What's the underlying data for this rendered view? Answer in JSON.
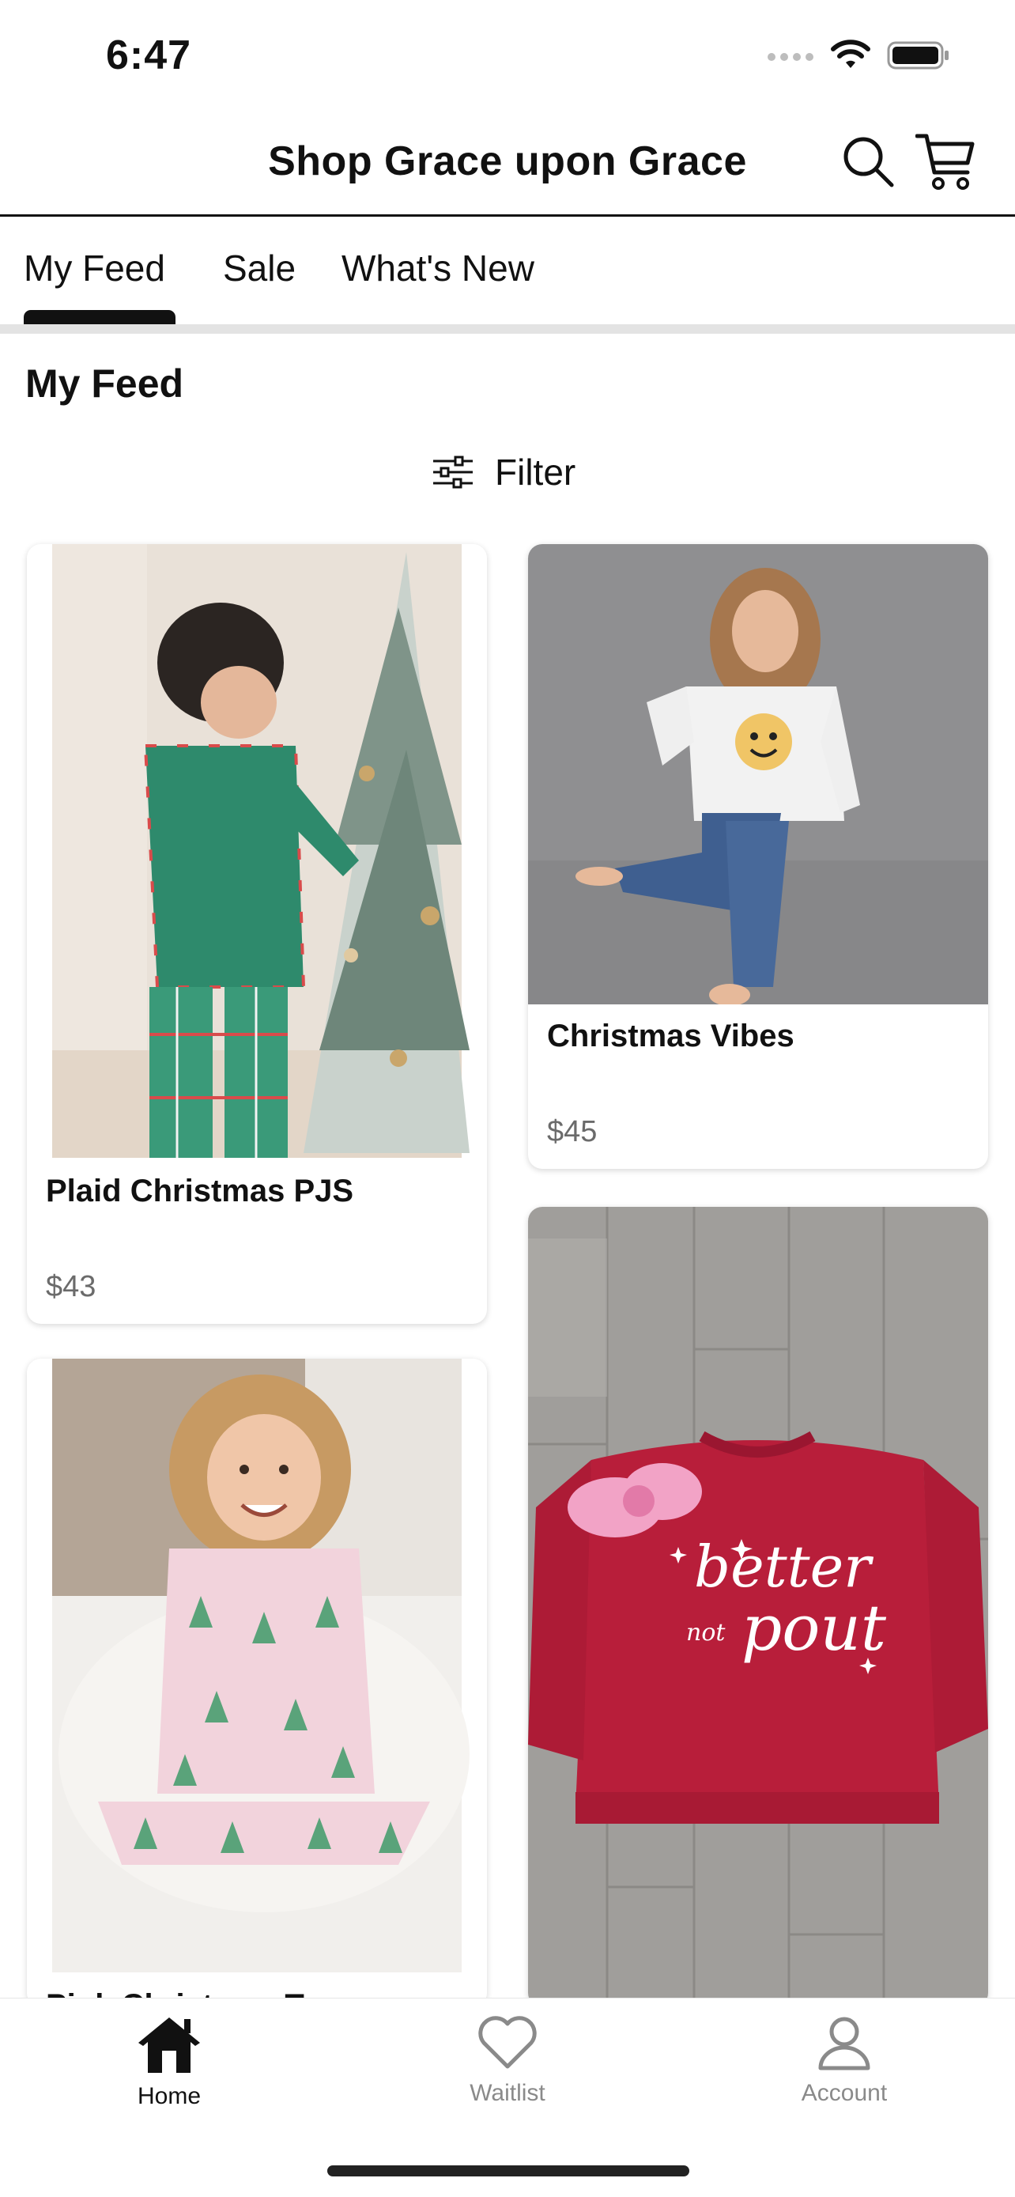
{
  "status_bar": {
    "time": "6:47"
  },
  "header": {
    "title": "Shop Grace upon Grace",
    "search_icon": "search-icon",
    "cart_icon": "cart-icon"
  },
  "tabs": [
    {
      "label": "My Feed",
      "active": true
    },
    {
      "label": "Sale",
      "active": false
    },
    {
      "label": "What's New",
      "active": false
    }
  ],
  "feed": {
    "title": "My Feed",
    "filter_label": "Filter",
    "products": [
      {
        "name": "Plaid Christmas PJS",
        "price": "$43"
      },
      {
        "name": "Christmas Vibes",
        "price": "$45"
      },
      {
        "name": "Pink Christmas T..."
      },
      {
        "name": ""
      }
    ]
  },
  "bottom_nav": {
    "items": [
      {
        "label": "Home",
        "icon": "home-icon",
        "active": true
      },
      {
        "label": "Waitlist",
        "icon": "heart-icon",
        "active": false
      },
      {
        "label": "Account",
        "icon": "person-icon",
        "active": false
      }
    ]
  },
  "colors": {
    "accent": "#111111",
    "inactive": "#8a8a8a",
    "price": "#6b6b6b",
    "divider": "#e3e3e3"
  }
}
